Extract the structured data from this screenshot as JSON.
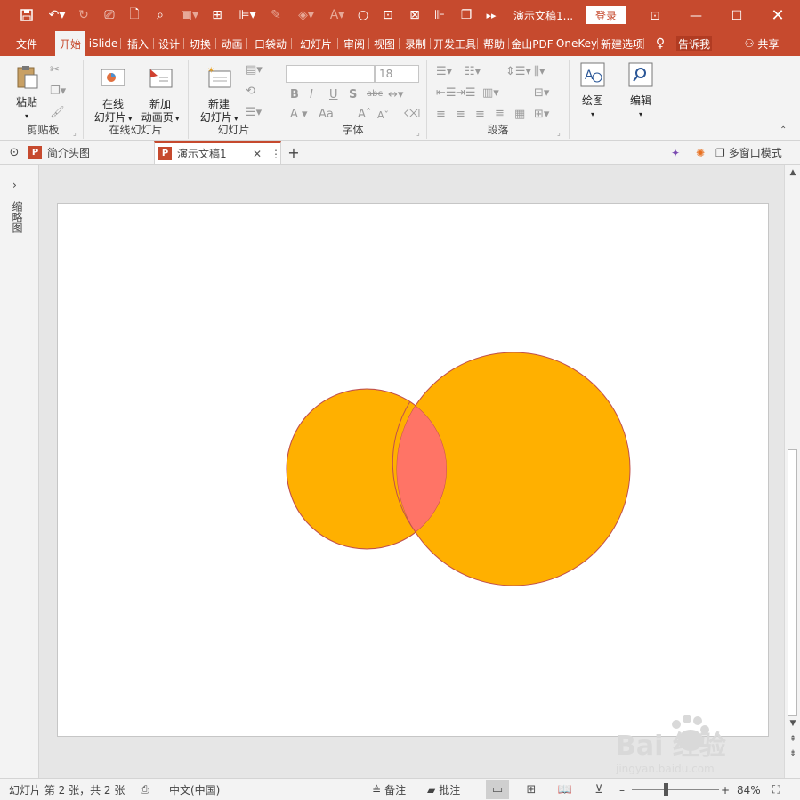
{
  "titlebar": {
    "doc_title": "演示文稿1...",
    "login_label": "登录",
    "qa_icons": [
      "save-icon",
      "undo-icon",
      "redo-icon",
      "slideshow-icon",
      "new-icon",
      "preview-icon",
      "image-icon",
      "grid-icon",
      "align-icon",
      "eyedropper-icon",
      "fill-icon",
      "font-color-icon",
      "circle-icon",
      "snapshot-icon",
      "copy-icon",
      "more-icon"
    ]
  },
  "ribbon_tabs": [
    "文件",
    "开始",
    "iSlide",
    "插入",
    "设计",
    "切换",
    "动画",
    "口袋动",
    "幻灯片",
    "审阅",
    "视图",
    "录制",
    "开发工具",
    "帮助",
    "金山PDF",
    "OneKey",
    "新建选项"
  ],
  "tell_me": "告诉我",
  "share_label": "共享",
  "ribbon": {
    "clipboard": {
      "paste": "粘贴",
      "group": "剪贴板"
    },
    "online_slides": {
      "online_btn_line1": "在线",
      "online_btn_line2": "幻灯片",
      "anim_btn_line1": "新加",
      "anim_btn_line2": "动画页",
      "group": "在线幻灯片"
    },
    "slides": {
      "new_line1": "新建",
      "new_line2": "幻灯片",
      "group": "幻灯片"
    },
    "font": {
      "font_name": "",
      "font_size": "18",
      "group": "字体",
      "bold": "B",
      "italic": "I",
      "underline": "U",
      "shadow": "S",
      "strike": "abc",
      "aa": "Aa"
    },
    "paragraph": {
      "group": "段落"
    },
    "drawing": {
      "label": "绘图"
    },
    "editing": {
      "label": "编辑"
    }
  },
  "doc_tabs": [
    {
      "label": "简介头图",
      "active": false
    },
    {
      "label": "演示文稿1",
      "active": true
    }
  ],
  "docbar_right": {
    "multiwindow": "多窗口模式"
  },
  "left_pane": {
    "label": "缩略图"
  },
  "slide": {
    "circle_fill": "#FFB000",
    "circle_stroke": "#C0504D",
    "overlap_fill": "#FF7466"
  },
  "statusbar": {
    "slide_info": "幻灯片 第 2 张，共 2 张",
    "language": "中文(中国)",
    "notes": "备注",
    "comments": "批注",
    "zoom": "84%"
  },
  "watermark": {
    "brand": "Bai 经验",
    "url": "jingyan.baidu.com"
  },
  "colors": {
    "accent": "#C64A2E",
    "ribbon_bg": "#F3F3F3"
  }
}
